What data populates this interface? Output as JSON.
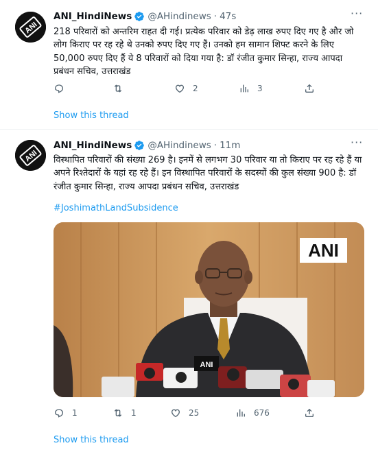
{
  "tweets": [
    {
      "name": "ANI_HindiNews",
      "handle": "@AHindinews",
      "separator": "·",
      "time": "47s",
      "text": "218 परिवारों को अन्तरिम राहत दी गई। प्रत्येक परिवार को डेढ़ लाख रुपए दिए गए है और जो लोग किराए पर रह रहे थे उनको रुपए दिए गए हैं। उनको हम सामान शिफ्ट करने के लिए 50,000 रुपए दिए हैं ये 8 परिवारों को दिया गया है: डॉ रंजीत कुमार सिन्हा, राज्य आपदा प्रबंधन सचिव, उत्तराखंड",
      "hashtag": "",
      "actions": {
        "replies": "",
        "retweets": "",
        "likes": "2",
        "views": "3"
      },
      "show_thread": "Show this thread",
      "avatar_text": "ANI"
    },
    {
      "name": "ANI_HindiNews",
      "handle": "@AHindinews",
      "separator": "·",
      "time": "11m",
      "text": "विस्थापित परिवारों की संख्या 269 है। इनमें से लगभग 30 परिवार या तो किराए पर रह रहे हैं या अपने रिश्तेदारों के यहां रह रहे हैं। इन विस्थापित परिवारों के सदस्यों की कुल संख्या 900 है: डॉ रंजीत कुमार सिन्हा, राज्य आपदा प्रबंधन सचिव, उत्तराखंड",
      "hashtag": "#JoshimathLandSubsidence",
      "media_watermark": "ANI",
      "actions": {
        "replies": "1",
        "retweets": "1",
        "likes": "25",
        "views": "676"
      },
      "show_thread": "Show this thread",
      "avatar_text": "ANI"
    }
  ],
  "icons": {
    "verified": "verified-badge-icon",
    "more": "more-options-icon",
    "reply": "reply-icon",
    "retweet": "retweet-icon",
    "like": "heart-icon",
    "views": "views-chart-icon",
    "share": "share-icon"
  },
  "colors": {
    "accent": "#1d9bf0",
    "secondary_text": "#536471",
    "primary_text": "#0f1419"
  }
}
